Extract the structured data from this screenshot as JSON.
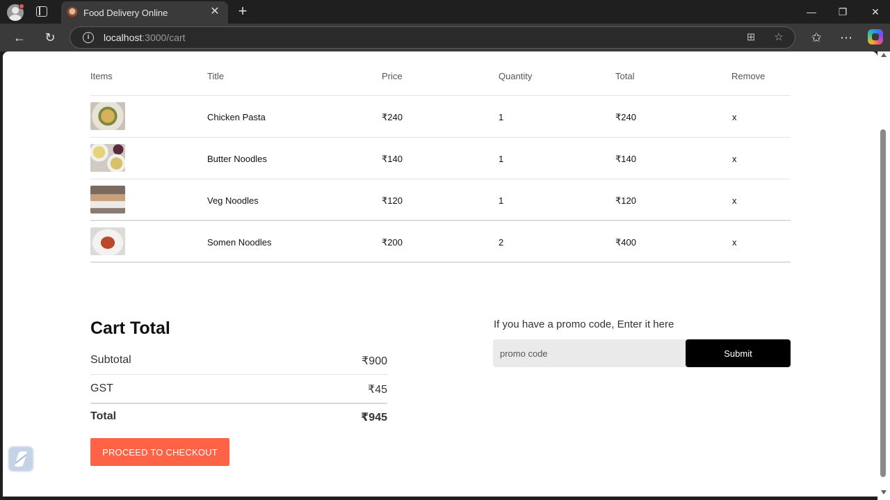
{
  "browser": {
    "tab_title": "Food Delivery Online",
    "url_host": "localhost",
    "url_rest": ":3000/cart"
  },
  "cart": {
    "headers": {
      "items": "Items",
      "title": "Title",
      "price": "Price",
      "quantity": "Quantity",
      "total": "Total",
      "remove": "Remove"
    },
    "rows": [
      {
        "title": "Chicken Pasta",
        "price": "₹240",
        "quantity": "1",
        "total": "₹240",
        "remove": "x"
      },
      {
        "title": "Butter Noodles",
        "price": "₹140",
        "quantity": "1",
        "total": "₹140",
        "remove": "x"
      },
      {
        "title": "Veg Noodles",
        "price": "₹120",
        "quantity": "1",
        "total": "₹120",
        "remove": "x"
      },
      {
        "title": "Somen Noodles",
        "price": "₹200",
        "quantity": "2",
        "total": "₹400",
        "remove": "x"
      }
    ]
  },
  "summary": {
    "heading": "Cart Total",
    "subtotal_label": "Subtotal",
    "subtotal_value": "₹900",
    "gst_label": "GST",
    "gst_value": "₹45",
    "total_label": "Total",
    "total_value": "₹945",
    "checkout_label": "PROCEED TO CHECKOUT"
  },
  "promo": {
    "text": "If you have a promo code, Enter it here",
    "placeholder": "promo code",
    "submit_label": "Submit"
  },
  "colors": {
    "accent": "#ff6347",
    "submit": "#000000"
  }
}
